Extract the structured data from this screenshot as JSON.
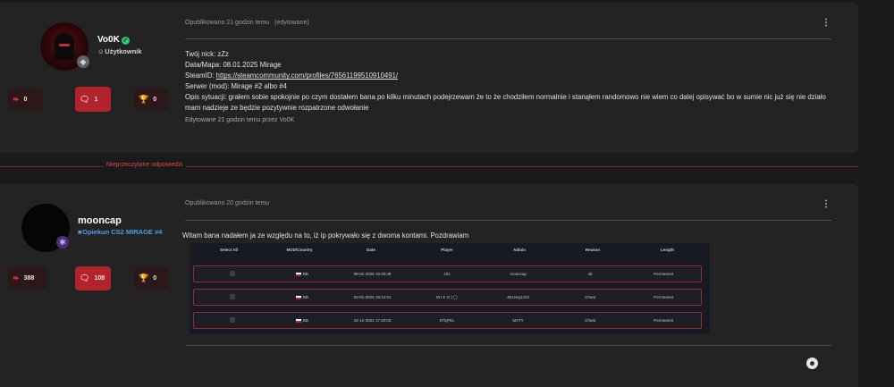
{
  "post1": {
    "author": {
      "name": "Vo0K",
      "role": "Użytkownik"
    },
    "stats": {
      "likes": "0",
      "posts": "1",
      "trophies": "0"
    },
    "meta": {
      "posted": "Opublikowano 21 godzin temu",
      "edited_tag": "(edytowane)"
    },
    "lines": {
      "nick": "Twój nick: zZz",
      "date_map": "Data/Mapa: 08.01.2025 Mirage",
      "steamid_label": "SteamID: ",
      "steamid_link": "https://steamcommunity.com/profiles/76561199510910491/",
      "server": "Serwer (mod): Mirage #2 albo #4",
      "situation": "Opis sytuacji: grałem sobie spokojnie po czym dostałem bana po kilku minutach podejrzewam że to że chodziłem normalnie i stanąłem randomowo nie wiem co dalej opisywać bo w sumie nic już się nie działo mam nadzieje ze będzie pozytywnie rozpatrzone odwołanie"
    },
    "edited_note": "Edytowane 21 godzin temu przez Vo0K"
  },
  "separator_label": "Nieprzeczytane odpowiedzi",
  "post2": {
    "author": {
      "name": "mooncap",
      "role": "Opiekun CS2 MIRAGE #4"
    },
    "stats": {
      "likes": "388",
      "posts": "108",
      "trophies": "0"
    },
    "meta": {
      "posted": "Opublikowano 20 godzin temu"
    },
    "text": "Witam bana nadałem ja ze względu na to, iż ip pokrywało się z dwoma kontami. Pozdrawiam",
    "bans_table": {
      "headers": [
        "Select All",
        "MOD/Country",
        "Date",
        "Player",
        "Admin",
        "Reason",
        "Length"
      ],
      "rows": [
        {
          "mod": "BB",
          "date": "08-01-2025 19:29:49",
          "player": "zZz",
          "admin": "mooncap",
          "reason": "xb",
          "length": "Permanent"
        },
        {
          "mod": "BB",
          "date": "02-01-2025 18:12:51",
          "player": "M I K O | ◯",
          "admin": "Zezzeg1232",
          "reason": "Cheat",
          "length": "Permanent"
        },
        {
          "mod": "BB",
          "date": "22-12-2024 17:20:03",
          "player": "STĘPEL",
          "admin": "MATY",
          "reason": "Cheat",
          "length": "Permanent"
        }
      ]
    }
  }
}
